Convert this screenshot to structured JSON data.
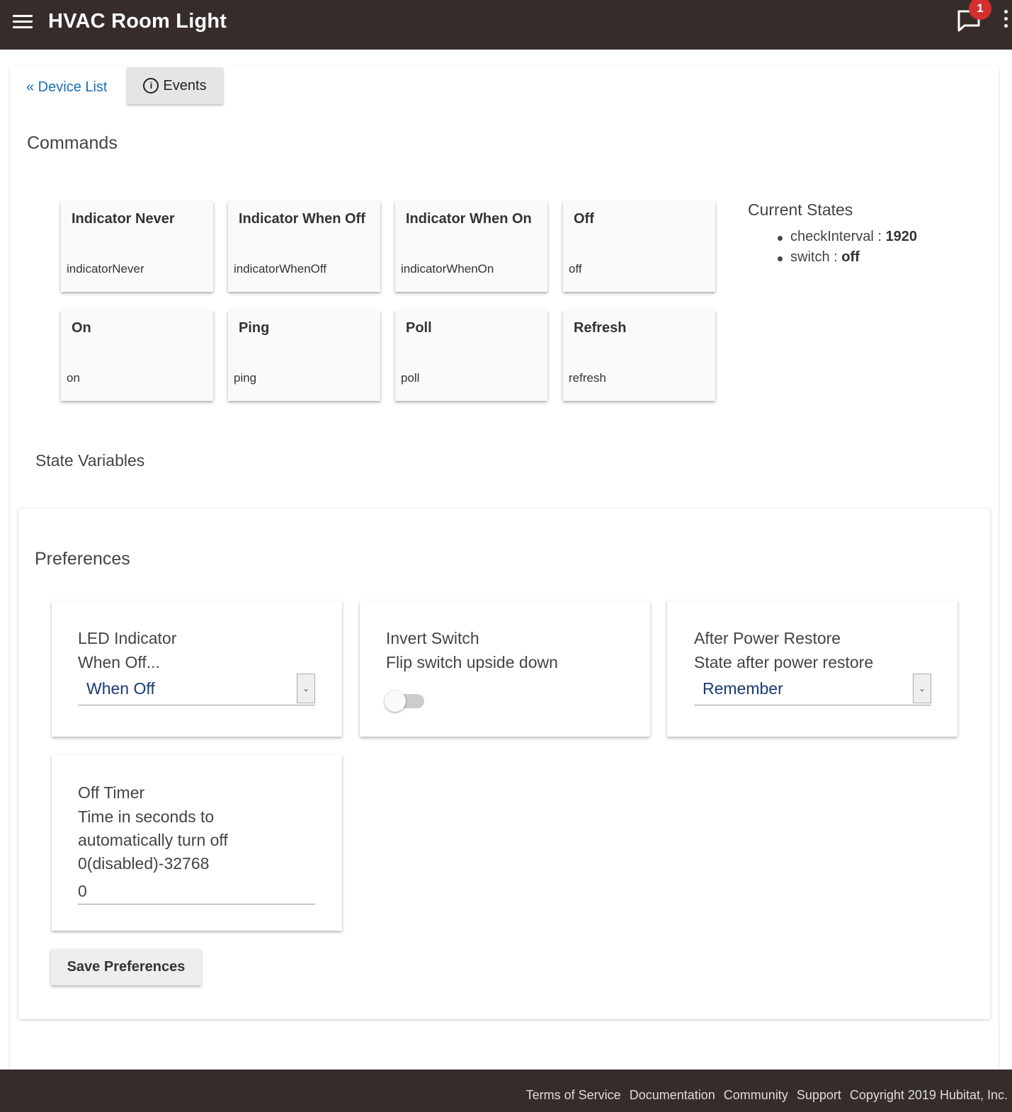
{
  "header": {
    "title": "HVAC Room Light",
    "notification_count": "1"
  },
  "nav": {
    "device_list_label": "« Device List",
    "events_label": "Events"
  },
  "sections": {
    "commands": "Commands",
    "state_variables": "State Variables",
    "preferences": "Preferences",
    "current_states": "Current States"
  },
  "commands": [
    {
      "name": "Indicator Never",
      "value": "indicatorNever"
    },
    {
      "name": "Indicator When Off",
      "value": "indicatorWhenOff"
    },
    {
      "name": "Indicator When On",
      "value": "indicatorWhenOn"
    },
    {
      "name": "Off",
      "value": "off"
    },
    {
      "name": "On",
      "value": "on"
    },
    {
      "name": "Ping",
      "value": "ping"
    },
    {
      "name": "Poll",
      "value": "poll"
    },
    {
      "name": "Refresh",
      "value": "refresh"
    }
  ],
  "current_states": [
    {
      "key": "checkInterval",
      "sep": " : ",
      "value": "1920"
    },
    {
      "key": "switch",
      "sep": " : ",
      "value": "off"
    }
  ],
  "preferences": {
    "led_indicator": {
      "title": "LED Indicator",
      "desc": "When Off...",
      "selected": "When Off"
    },
    "invert_switch": {
      "title": "Invert Switch",
      "desc": "Flip switch upside down",
      "enabled": false
    },
    "after_power_restore": {
      "title": "After Power Restore",
      "desc": "State after power restore",
      "selected": "Remember"
    },
    "off_timer": {
      "title": "Off Timer",
      "desc_line1": "Time in seconds to",
      "desc_line2": "automatically turn off",
      "desc_line3": "0(disabled)-32768",
      "value": "0"
    },
    "save_label": "Save Preferences"
  },
  "footer": {
    "terms": "Terms of Service",
    "documentation": "Documentation",
    "community": "Community",
    "support": "Support",
    "copyright": "Copyright 2019 Hubitat, Inc."
  },
  "colors": {
    "header_bg": "#362d2b",
    "link": "#1a6fb5",
    "badge": "#d32f2f"
  }
}
